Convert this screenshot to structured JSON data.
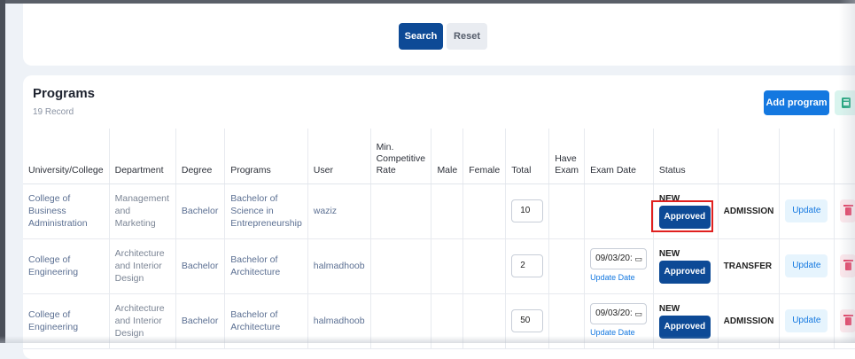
{
  "search": {
    "search_label": "Search",
    "reset_label": "Reset"
  },
  "programs": {
    "title": "Programs",
    "record_count": "19 Record",
    "add_label": "Add program",
    "export_icon": "excel-export-icon",
    "columns": [
      "University/College",
      "Department",
      "Degree",
      "Programs",
      "User",
      "Min. Competitive Rate",
      "Male",
      "Female",
      "Total",
      "Have Exam",
      "Exam Date",
      "Status"
    ],
    "rows": [
      {
        "college": "College of Business Administration",
        "department": "Management and Marketing",
        "degree": "Bachelor",
        "program": "Bachelor of Science in Entrepreneurship",
        "user": "waziz",
        "min_rate": "",
        "male": "",
        "female": "",
        "total": "10",
        "have_exam": "",
        "exam_date": "",
        "update_date": "",
        "status": "NEW",
        "approved": "Approved",
        "type": "ADMISSION",
        "update": "Update"
      },
      {
        "college": "College of Engineering",
        "department": "Architecture and Interior Design",
        "degree": "Bachelor",
        "program": "Bachelor of Architecture",
        "user": "halmadhoob",
        "min_rate": "",
        "male": "",
        "female": "",
        "total": "2",
        "have_exam": "",
        "exam_date": "09/03/20:",
        "update_date": "Update Date",
        "status": "NEW",
        "approved": "Approved",
        "type": "TRANSFER",
        "update": "Update"
      },
      {
        "college": "College of Engineering",
        "department": "Architecture and Interior Design",
        "degree": "Bachelor",
        "program": "Bachelor of Architecture",
        "user": "halmadhoob",
        "min_rate": "",
        "male": "",
        "female": "",
        "total": "50",
        "have_exam": "",
        "exam_date": "09/03/20:",
        "update_date": "Update Date",
        "status": "NEW",
        "approved": "Approved",
        "type": "ADMISSION",
        "update": "Update"
      }
    ]
  },
  "colors": {
    "primary": "#0d4a96",
    "accent": "#1478e0",
    "highlight": "#e0201f",
    "delete": "#e3345c"
  }
}
